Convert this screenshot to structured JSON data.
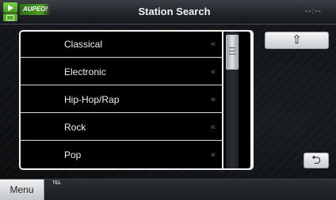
{
  "header": {
    "source_label": "AUPEO!",
    "title": "Station Search",
    "clock": "--:--"
  },
  "stations": [
    {
      "label": "Classical",
      "arrow": "«"
    },
    {
      "label": "Electronic",
      "arrow": "«"
    },
    {
      "label": "Hip-Hop/Rap",
      "arrow": "«"
    },
    {
      "label": "Rock",
      "arrow": "«"
    },
    {
      "label": "Pop",
      "arrow": "«"
    }
  ],
  "scrollbar": {
    "position": 0.0
  },
  "buttons": {
    "up_symbol": "⇧",
    "back_symbol": "⮌"
  },
  "bottom_bar": {
    "menu_label": "Menu",
    "tel_label": "TEL"
  },
  "icons": {
    "source": "play-icon",
    "up": "up-arrow-icon",
    "back": "return-icon"
  }
}
